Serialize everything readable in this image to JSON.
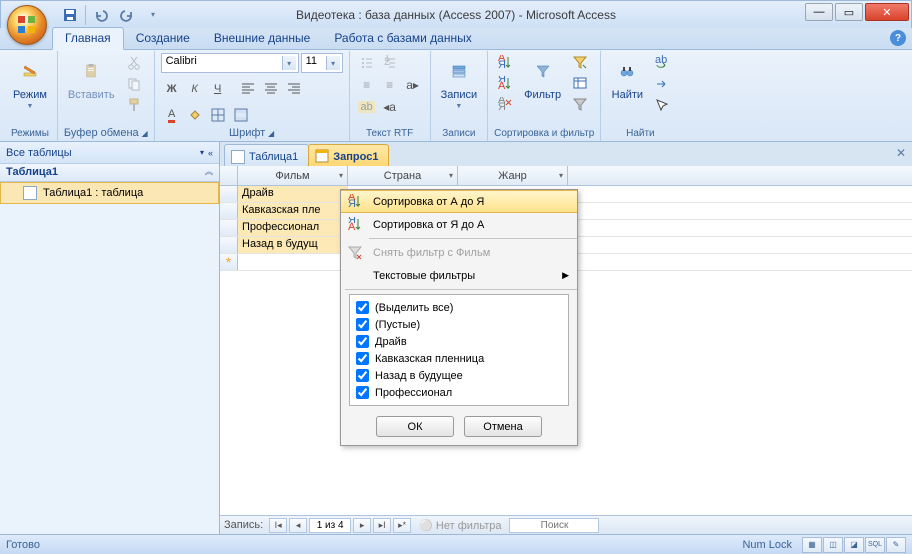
{
  "title": "Видеотека : база данных (Access 2007)  -  Microsoft Access",
  "ribbon_tabs": [
    "Главная",
    "Создание",
    "Внешние данные",
    "Работа с базами данных"
  ],
  "ribbon": {
    "modes_label": "Режимы",
    "mode_btn": "Режим",
    "clipboard_label": "Буфер обмена",
    "paste_btn": "Вставить",
    "font_label": "Шрифт",
    "font_name": "Calibri",
    "font_size": "11",
    "rtf_label": "Текст RTF",
    "records_label": "Записи",
    "records_btn": "Записи",
    "sortfilter_label": "Сортировка и фильтр",
    "filter_btn": "Фильтр",
    "find_label": "Найти",
    "find_btn": "Найти"
  },
  "nav": {
    "header": "Все таблицы",
    "group": "Таблица1",
    "items": [
      "Таблица1 : таблица"
    ]
  },
  "doc_tabs": [
    {
      "label": "Таблица1",
      "active": false
    },
    {
      "label": "Запрос1",
      "active": true
    }
  ],
  "grid": {
    "columns": [
      "Фильм",
      "Страна",
      "Жанр"
    ],
    "rows": [
      "Драйв",
      "Кавказская пле",
      "Профессионал",
      "Назад в будущ"
    ]
  },
  "recnav": {
    "label": "Запись:",
    "pos": "1 из 4",
    "nofilter": "Нет фильтра",
    "search": "Поиск"
  },
  "dropdown": {
    "sort_asc": "Сортировка от А до Я",
    "sort_desc": "Сортировка от Я до А",
    "clear_filter": "Снять фильтр с Фильм",
    "text_filters": "Текстовые фильтры",
    "checks": [
      "(Выделить все)",
      "(Пустые)",
      "Драйв",
      "Кавказская пленница",
      "Назад в будущее",
      "Профессионал"
    ],
    "ok": "ОК",
    "cancel": "Отмена"
  },
  "status": {
    "ready": "Готово",
    "numlock": "Num Lock"
  }
}
